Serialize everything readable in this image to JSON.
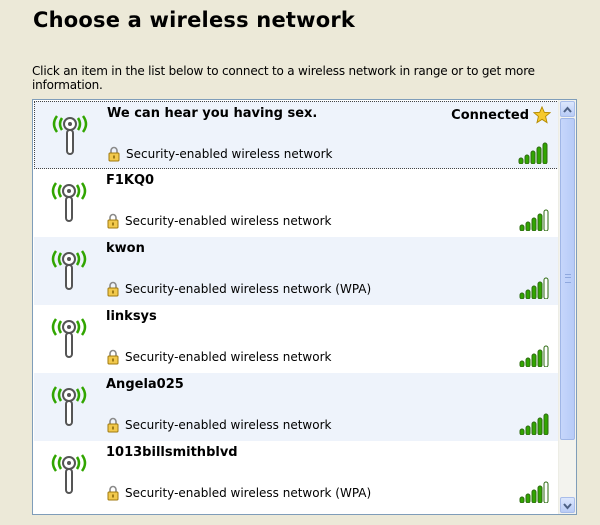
{
  "header": {
    "title": "Choose a wireless network",
    "description": "Click an item in the list below to connect to a wireless network in range or to get more information."
  },
  "networks": [
    {
      "name": "We can hear you having sex.",
      "security": "Security-enabled wireless network",
      "status": "Connected",
      "selected": true,
      "signal_bars": 5
    },
    {
      "name": "F1KQ0",
      "security": "Security-enabled wireless network",
      "status": "",
      "selected": false,
      "signal_bars": 4
    },
    {
      "name": "kwon",
      "security": "Security-enabled wireless network (WPA)",
      "status": "",
      "selected": false,
      "signal_bars": 4
    },
    {
      "name": "linksys",
      "security": "Security-enabled wireless network",
      "status": "",
      "selected": false,
      "signal_bars": 4
    },
    {
      "name": "Angela025",
      "security": "Security-enabled wireless network",
      "status": "",
      "selected": false,
      "signal_bars": 5
    },
    {
      "name": "1013billsmithblvd",
      "security": "Security-enabled wireless network (WPA)",
      "status": "",
      "selected": false,
      "signal_bars": 4
    }
  ],
  "colors": {
    "signal_on": "#31A500",
    "signal_off": "#FFFFFF",
    "star": "#F6C92E",
    "accent": "#316AC5"
  },
  "icons": {
    "network": "wireless-antenna-icon",
    "security": "lock-icon",
    "preferred": "star-icon",
    "signal": "signal-strength-icon"
  }
}
